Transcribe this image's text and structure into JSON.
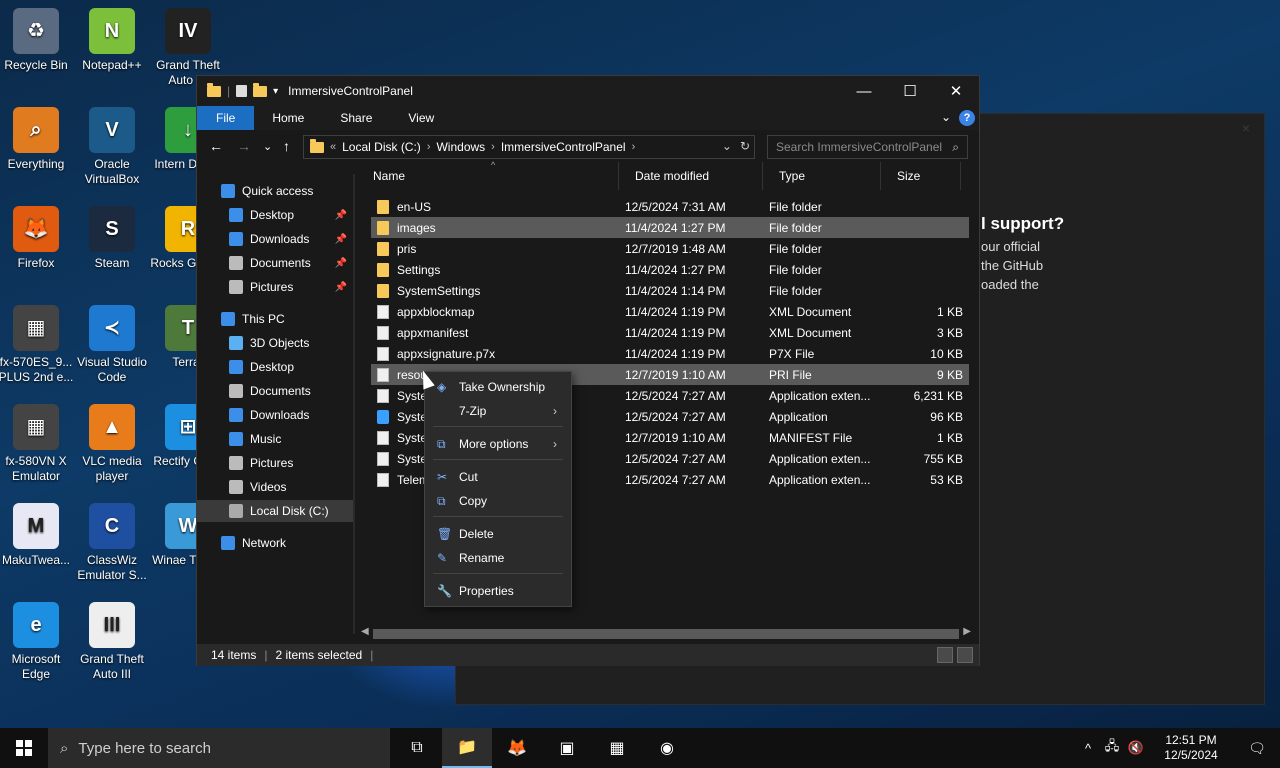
{
  "desktop": {
    "icons": [
      {
        "label": "Recycle Bin",
        "glyph": "♻",
        "color": "#5a6a80"
      },
      {
        "label": "Everything",
        "glyph": "⌕",
        "color": "#e07b20"
      },
      {
        "label": "Firefox",
        "glyph": "🦊",
        "color": "#e05a10"
      },
      {
        "label": "fx-570ES_9... PLUS 2nd e...",
        "glyph": "▦",
        "color": "#444"
      },
      {
        "label": "fx-580VN X Emulator",
        "glyph": "▦",
        "color": "#444"
      },
      {
        "label": "MakuTwea...",
        "glyph": "M",
        "color": "#e8e8f5"
      },
      {
        "label": "Microsoft Edge",
        "glyph": "e",
        "color": "#1d8fe0"
      },
      {
        "label": "Notepad++",
        "glyph": "N",
        "color": "#7bbf3a"
      },
      {
        "label": "Oracle VirtualBox",
        "glyph": "V",
        "color": "#1c5a8a"
      },
      {
        "label": "Steam",
        "glyph": "S",
        "color": "#1b2a3e"
      },
      {
        "label": "Visual Studio Code",
        "glyph": "≺",
        "color": "#1d7ad0"
      },
      {
        "label": "VLC media player",
        "glyph": "▲",
        "color": "#e87c1a"
      },
      {
        "label": "ClassWiz Emulator S...",
        "glyph": "C",
        "color": "#1f4fa0"
      },
      {
        "label": "Grand Theft Auto III",
        "glyph": "III",
        "color": "#eee"
      },
      {
        "label": "Grand Theft Auto IV",
        "glyph": "IV",
        "color": "#222"
      },
      {
        "label": "Intern Downl",
        "glyph": "↓",
        "color": "#2e9d3e"
      },
      {
        "label": "Rocks Games",
        "glyph": "R",
        "color": "#f1b400"
      },
      {
        "label": "Terrar",
        "glyph": "T",
        "color": "#4d7a3a"
      },
      {
        "label": "Rectify Contr",
        "glyph": "⊞",
        "color": "#1d8fe0"
      },
      {
        "label": "Winae Tweak",
        "glyph": "W",
        "color": "#3a9ad8"
      }
    ]
  },
  "bg_window": {
    "heading": "l support?",
    "lines": [
      "our official",
      "the GitHub",
      "oaded the"
    ],
    "close": "×"
  },
  "window": {
    "title": "ImmersiveControlPanel",
    "controls": {
      "minimize": "—",
      "maximize": "☐",
      "close": "✕"
    },
    "ribbon": {
      "file": "File",
      "home": "Home",
      "share": "Share",
      "view": "View",
      "help": "?",
      "collapse": "⌄"
    },
    "nav": {
      "back": "←",
      "forward": "→",
      "recent": "⌄",
      "up": "↑"
    },
    "address": {
      "prefix": "«",
      "crumbs": [
        "Local Disk (C:)",
        "Windows",
        "ImmersiveControlPanel"
      ],
      "sep": "›",
      "dropdown": "⌄",
      "refresh": "↻"
    },
    "search_placeholder": "Search ImmersiveControlPanel",
    "nav_pane": [
      {
        "label": "Quick access",
        "icon": "star-icon",
        "color": "#3b8fe8",
        "pin": false,
        "indent": 0
      },
      {
        "label": "Desktop",
        "icon": "desktop-icon",
        "color": "#3b8fe8",
        "pin": true,
        "indent": 1
      },
      {
        "label": "Downloads",
        "icon": "download-icon",
        "color": "#3b8fe8",
        "pin": true,
        "indent": 1
      },
      {
        "label": "Documents",
        "icon": "document-icon",
        "color": "#bbb",
        "pin": true,
        "indent": 1
      },
      {
        "label": "Pictures",
        "icon": "picture-icon",
        "color": "#bbb",
        "pin": true,
        "indent": 1
      },
      {
        "label": "This PC",
        "icon": "computer-icon",
        "color": "#3b8fe8",
        "pin": false,
        "indent": 0
      },
      {
        "label": "3D Objects",
        "icon": "cube-icon",
        "color": "#5ab0f0",
        "pin": false,
        "indent": 1
      },
      {
        "label": "Desktop",
        "icon": "desktop-icon",
        "color": "#3b8fe8",
        "pin": false,
        "indent": 1
      },
      {
        "label": "Documents",
        "icon": "document-icon",
        "color": "#bbb",
        "pin": false,
        "indent": 1
      },
      {
        "label": "Downloads",
        "icon": "download-icon",
        "color": "#3b8fe8",
        "pin": false,
        "indent": 1
      },
      {
        "label": "Music",
        "icon": "music-icon",
        "color": "#3b8fe8",
        "pin": false,
        "indent": 1
      },
      {
        "label": "Pictures",
        "icon": "picture-icon",
        "color": "#bbb",
        "pin": false,
        "indent": 1
      },
      {
        "label": "Videos",
        "icon": "video-icon",
        "color": "#bbb",
        "pin": false,
        "indent": 1
      },
      {
        "label": "Local Disk (C:)",
        "icon": "drive-icon",
        "color": "#aaa",
        "pin": false,
        "indent": 1,
        "selected": true
      },
      {
        "label": "Network",
        "icon": "network-icon",
        "color": "#3b8fe8",
        "pin": false,
        "indent": 0
      }
    ],
    "columns": [
      "Name",
      "Date modified",
      "Type",
      "Size"
    ],
    "files": [
      {
        "name": "en-US",
        "date": "12/5/2024 7:31 AM",
        "type": "File folder",
        "size": "",
        "kind": "folder",
        "selected": false
      },
      {
        "name": "images",
        "date": "11/4/2024 1:27 PM",
        "type": "File folder",
        "size": "",
        "kind": "folder",
        "selected": true
      },
      {
        "name": "pris",
        "date": "12/7/2019 1:48 AM",
        "type": "File folder",
        "size": "",
        "kind": "folder",
        "selected": false
      },
      {
        "name": "Settings",
        "date": "11/4/2024 1:27 PM",
        "type": "File folder",
        "size": "",
        "kind": "folder",
        "selected": false
      },
      {
        "name": "SystemSettings",
        "date": "11/4/2024 1:14 PM",
        "type": "File folder",
        "size": "",
        "kind": "folder",
        "selected": false
      },
      {
        "name": "appxblockmap",
        "date": "11/4/2024 1:19 PM",
        "type": "XML Document",
        "size": "1 KB",
        "kind": "doc",
        "selected": false
      },
      {
        "name": "appxmanifest",
        "date": "11/4/2024 1:19 PM",
        "type": "XML Document",
        "size": "3 KB",
        "kind": "doc",
        "selected": false
      },
      {
        "name": "appxsignature.p7x",
        "date": "11/4/2024 1:19 PM",
        "type": "P7X File",
        "size": "10 KB",
        "kind": "doc",
        "selected": false
      },
      {
        "name": "resou",
        "date": "12/7/2019 1:10 AM",
        "type": "PRI File",
        "size": "9 KB",
        "kind": "doc",
        "selected": true
      },
      {
        "name": "Syste",
        "date": "12/5/2024 7:27 AM",
        "type": "Application exten...",
        "size": "6,231 KB",
        "kind": "doc",
        "selected": false
      },
      {
        "name": "Syste",
        "date": "12/5/2024 7:27 AM",
        "type": "Application",
        "size": "96 KB",
        "kind": "app",
        "selected": false
      },
      {
        "name": "Syste",
        "date": "12/7/2019 1:10 AM",
        "type": "MANIFEST File",
        "size": "1 KB",
        "kind": "doc",
        "selected": false
      },
      {
        "name": "Syste                              p.dll",
        "date": "12/5/2024 7:27 AM",
        "type": "Application exten...",
        "size": "755 KB",
        "kind": "doc",
        "selected": false
      },
      {
        "name": "Telem",
        "date": "12/5/2024 7:27 AM",
        "type": "Application exten...",
        "size": "53 KB",
        "kind": "doc",
        "selected": false
      }
    ],
    "status": {
      "items": "14 items",
      "divider": "|",
      "selected": "2 items selected",
      "end": "|"
    }
  },
  "context_menu": {
    "items": [
      {
        "label": "Take Ownership",
        "icon": "shield-icon",
        "glyph": "◈",
        "submenu": false
      },
      {
        "label": "7-Zip",
        "icon": "",
        "glyph": "",
        "submenu": true
      },
      {
        "label": "More options",
        "icon": "more-options-icon",
        "glyph": "⧉",
        "submenu": true
      },
      {
        "label": "Cut",
        "icon": "cut-icon",
        "glyph": "✂",
        "submenu": false
      },
      {
        "label": "Copy",
        "icon": "copy-icon",
        "glyph": "⧉",
        "submenu": false
      },
      {
        "label": "Delete",
        "icon": "delete-icon",
        "glyph": "🗑",
        "submenu": false
      },
      {
        "label": "Rename",
        "icon": "rename-icon",
        "glyph": "✎",
        "submenu": false
      },
      {
        "label": "Properties",
        "icon": "properties-icon",
        "glyph": "🔧",
        "submenu": false
      }
    ],
    "submenu_arrow": "›"
  },
  "taskbar": {
    "search_placeholder": "Type here to search",
    "clock_time": "12:51 PM",
    "clock_date": "12/5/2024",
    "apps": [
      {
        "name": "task-view",
        "glyph": "⧉",
        "active": false
      },
      {
        "name": "file-explorer",
        "glyph": "📁",
        "active": true
      },
      {
        "name": "firefox",
        "glyph": "🦊",
        "active": false
      },
      {
        "name": "archive",
        "glyph": "▣",
        "active": false
      },
      {
        "name": "classwiz",
        "glyph": "▦",
        "active": false
      },
      {
        "name": "winaero",
        "glyph": "◉",
        "active": false
      }
    ],
    "tray": {
      "chevron": "^",
      "network": "🖧",
      "volume": "🔇",
      "notifications": "🗨"
    }
  }
}
